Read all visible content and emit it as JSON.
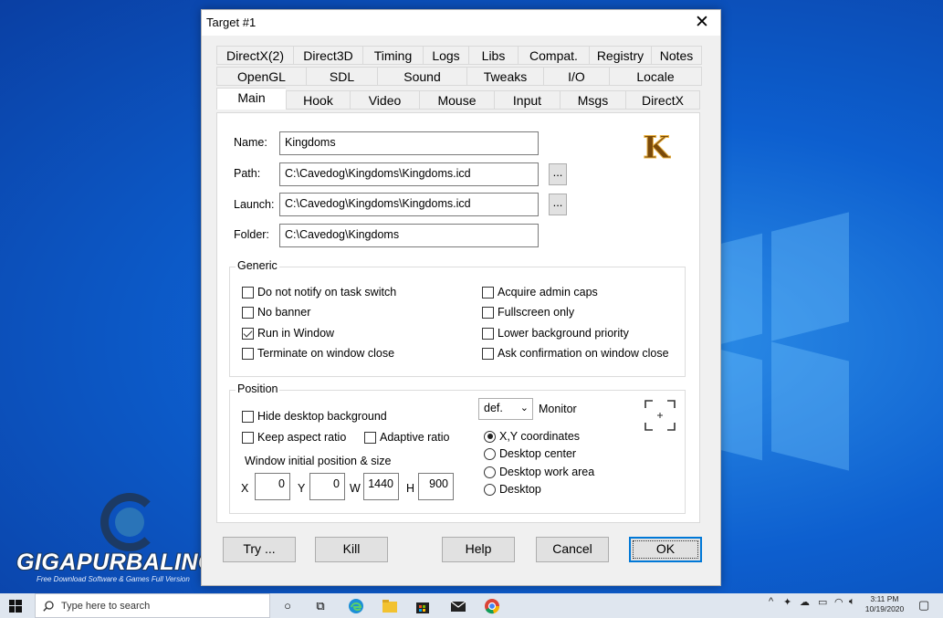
{
  "window": {
    "title": "Target #1"
  },
  "tabs": {
    "row1": [
      "DirectX(2)",
      "Direct3D",
      "Timing",
      "Logs",
      "Libs",
      "Compat.",
      "Registry",
      "Notes"
    ],
    "row2": [
      "OpenGL",
      "SDL",
      "Sound",
      "Tweaks",
      "I/O",
      "Locale"
    ],
    "row3": [
      "Main",
      "Hook",
      "Video",
      "Mouse",
      "Input",
      "Msgs",
      "DirectX"
    ],
    "active": "Main"
  },
  "main": {
    "name_label": "Name:",
    "name_value": "Kingdoms",
    "path_label": "Path:",
    "path_value": "C:\\Cavedog\\Kingdoms\\Kingdoms.icd",
    "launch_label": "Launch:",
    "launch_value": "C:\\Cavedog\\Kingdoms\\Kingdoms.icd",
    "folder_label": "Folder:",
    "folder_value": "C:\\Cavedog\\Kingdoms",
    "browse_label": "...",
    "game_icon_letter": "K"
  },
  "generic": {
    "title": "Generic",
    "left": [
      {
        "label": "Do not notify on task switch",
        "checked": false
      },
      {
        "label": "No banner",
        "checked": false
      },
      {
        "label": "Run in Window",
        "checked": true
      },
      {
        "label": "Terminate on window close",
        "checked": false
      }
    ],
    "right": [
      {
        "label": "Acquire admin caps",
        "checked": false
      },
      {
        "label": "Fullscreen only",
        "checked": false
      },
      {
        "label": "Lower background priority",
        "checked": false
      },
      {
        "label": "Ask confirmation on window close",
        "checked": false
      }
    ]
  },
  "position": {
    "title": "Position",
    "hide_desktop": "Hide desktop background",
    "keep_aspect": "Keep aspect ratio",
    "adaptive": "Adaptive ratio",
    "init_label": "Window initial position & size",
    "x_label": "X",
    "x_value": "0",
    "y_label": "Y",
    "y_value": "0",
    "w_label": "W",
    "w_value": "1440",
    "h_label": "H",
    "h_value": "900",
    "monitor_value": "def.",
    "monitor_label": "Monitor",
    "radios": [
      {
        "label": "X,Y coordinates",
        "selected": true
      },
      {
        "label": "Desktop center",
        "selected": false
      },
      {
        "label": "Desktop work area",
        "selected": false
      },
      {
        "label": "Desktop",
        "selected": false
      }
    ]
  },
  "buttons": {
    "try": "Try ...",
    "kill": "Kill",
    "help": "Help",
    "cancel": "Cancel",
    "ok": "OK"
  },
  "watermark": {
    "brand": "GIGAPURBALINGGA",
    "tagline": "Free Download Software & Games Full Version"
  },
  "taskbar": {
    "search_placeholder": "Type here to search",
    "time": "3:11 PM",
    "date": "10/19/2020"
  },
  "colors": {
    "desktop": "#0d5fcf",
    "accent": "#0078d7"
  }
}
